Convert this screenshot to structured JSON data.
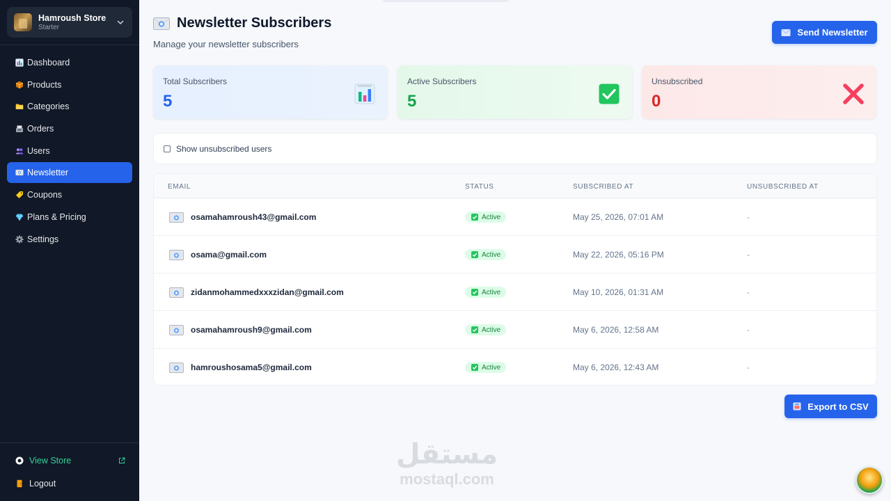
{
  "sidebar": {
    "store_name": "Hamroush Store",
    "store_plan": "Starter",
    "nav": [
      {
        "label": "Dashboard",
        "icon": "bar-chart-icon"
      },
      {
        "label": "Products",
        "icon": "package-icon"
      },
      {
        "label": "Categories",
        "icon": "folder-icon"
      },
      {
        "label": "Orders",
        "icon": "cash-register-icon"
      },
      {
        "label": "Users",
        "icon": "users-icon"
      },
      {
        "label": "Newsletter",
        "icon": "envelope-icon"
      },
      {
        "label": "Coupons",
        "icon": "tag-icon"
      },
      {
        "label": "Plans & Pricing",
        "icon": "gem-icon"
      },
      {
        "label": "Settings",
        "icon": "gear-icon"
      }
    ],
    "active_item": "Newsletter",
    "view_store": "View Store",
    "logout": "Logout"
  },
  "header": {
    "title": "Newsletter Subscribers",
    "subtitle": "Manage your newsletter subscribers",
    "send_button": "Send Newsletter"
  },
  "stats": {
    "total": {
      "label": "Total Subscribers",
      "value": "5",
      "color": "#2563eb"
    },
    "active": {
      "label": "Active Subscribers",
      "value": "5",
      "color": "#16a34a"
    },
    "unsubscribed": {
      "label": "Unsubscribed",
      "value": "0",
      "color": "#dc2626"
    }
  },
  "filter": {
    "show_unsubscribed_label": "Show unsubscribed users",
    "checked": false
  },
  "table": {
    "columns": [
      "EMAIL",
      "STATUS",
      "SUBSCRIBED AT",
      "UNSUBSCRIBED AT"
    ],
    "rows": [
      {
        "email": "osamahamroush43@gmail.com",
        "status": "Active",
        "subscribed_at": "May 25, 2026, 07:01 AM",
        "unsubscribed_at": "-"
      },
      {
        "email": "osama@gmail.com",
        "status": "Active",
        "subscribed_at": "May 22, 2026, 05:16 PM",
        "unsubscribed_at": "-"
      },
      {
        "email": "zidanmohammedxxxzidan@gmail.com",
        "status": "Active",
        "subscribed_at": "May 10, 2026, 01:31 AM",
        "unsubscribed_at": "-"
      },
      {
        "email": "osamahamroush9@gmail.com",
        "status": "Active",
        "subscribed_at": "May 6, 2026, 12:58 AM",
        "unsubscribed_at": "-"
      },
      {
        "email": "hamroushosama5@gmail.com",
        "status": "Active",
        "subscribed_at": "May 6, 2026, 12:43 AM",
        "unsubscribed_at": "-"
      }
    ]
  },
  "export_button": "Export to CSV",
  "watermark": {
    "arabic": "مستقل",
    "latin": "mostaql.com"
  },
  "colors": {
    "accent": "#2563eb",
    "sidebar_bg": "#111827",
    "view_store": "#34d399"
  }
}
